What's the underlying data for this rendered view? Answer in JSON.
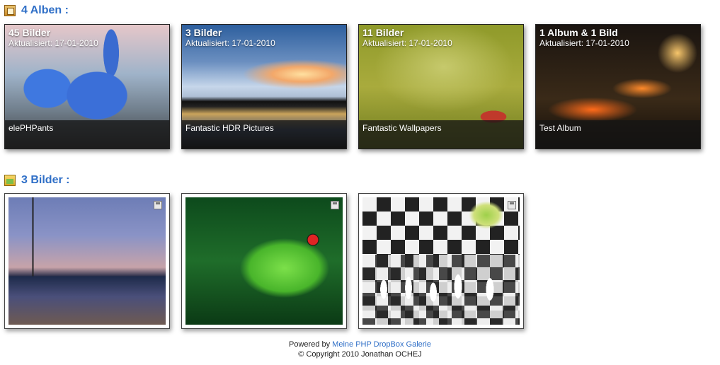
{
  "albums_section": {
    "title": "4 Alben :",
    "icon": "albums-icon",
    "items": [
      {
        "count": "45 Bilder",
        "updated": "Aktualisiert: 17-01-2010",
        "name": "elePHPants"
      },
      {
        "count": "3 Bilder",
        "updated": "Aktualisiert: 17-01-2010",
        "name": "Fantastic HDR Pictures"
      },
      {
        "count": "11 Bilder",
        "updated": "Aktualisiert: 17-01-2010",
        "name": "Fantastic Wallpapers"
      },
      {
        "count": "1 Album & 1 Bild",
        "updated": "Aktualisiert: 17-01-2010",
        "name": "Test Album"
      }
    ]
  },
  "pictures_section": {
    "title": "3 Bilder :",
    "icon": "pictures-icon",
    "save_icon": "save-icon"
  },
  "footer": {
    "powered_prefix": "Powered by",
    "link_text": "Meine PHP DropBox Galerie",
    "copyright": "© Copyright 2010 Jonathan OCHEJ"
  },
  "colors": {
    "accent": "#2f6fc7",
    "caption_bg": "#141414"
  }
}
